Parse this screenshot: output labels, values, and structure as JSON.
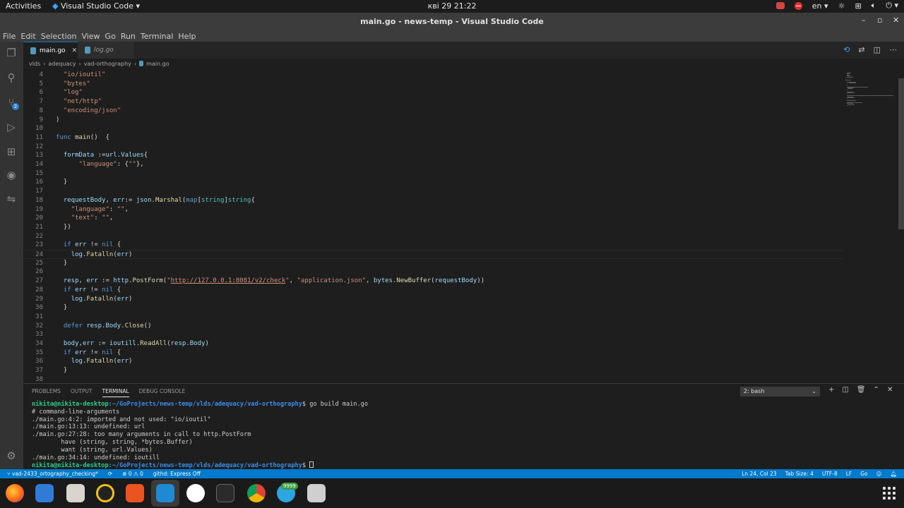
{
  "topbar": {
    "activities": "Activities",
    "app_name": "Visual Studio Code",
    "clock": "кві 29  21:22",
    "lang": "en"
  },
  "window": {
    "title": "main.go - news-temp - Visual Studio Code"
  },
  "menu": [
    "File",
    "Edit",
    "Selection",
    "View",
    "Go",
    "Run",
    "Terminal",
    "Help"
  ],
  "source_control_badge": "2",
  "tabs": [
    {
      "label": "main.go",
      "active": true
    },
    {
      "label": "log.go",
      "active": false
    }
  ],
  "breadcrumb": [
    "vlds",
    "adequacy",
    "vad-orthography",
    "main.go"
  ],
  "editor": {
    "lines": [
      {
        "n": "4",
        "text": "  \"io/ioutil\""
      },
      {
        "n": "5",
        "text": "  \"bytes\""
      },
      {
        "n": "6",
        "text": "  \"log\""
      },
      {
        "n": "7",
        "text": "  \"net/http\""
      },
      {
        "n": "8",
        "text": "  \"encoding/json\""
      },
      {
        "n": "9",
        "text": ")"
      },
      {
        "n": "10",
        "text": ""
      },
      {
        "n": "11",
        "text": "func main()  {"
      },
      {
        "n": "12",
        "text": ""
      },
      {
        "n": "13",
        "text": "  formData :=url.Values{"
      },
      {
        "n": "14",
        "text": "      \"language\": {\"\"},"
      },
      {
        "n": "15",
        "text": ""
      },
      {
        "n": "16",
        "text": "  }"
      },
      {
        "n": "17",
        "text": ""
      },
      {
        "n": "18",
        "text": "  requestBody, err:= json.Marshal(map[string]string{"
      },
      {
        "n": "19",
        "text": "    \"language\": \"\","
      },
      {
        "n": "20",
        "text": "    \"text\": \"\","
      },
      {
        "n": "21",
        "text": "  })"
      },
      {
        "n": "22",
        "text": ""
      },
      {
        "n": "23",
        "text": "  if err != nil {"
      },
      {
        "n": "24",
        "text": "    log.Fatalln(err)"
      },
      {
        "n": "25",
        "text": "  }"
      },
      {
        "n": "26",
        "text": ""
      },
      {
        "n": "27",
        "text": "  resp, err := http.PostForm(\"http://127.0.0.1:8081/v2/check\", \"application.json\", bytes.NewBuffer(requestBody))"
      },
      {
        "n": "28",
        "text": "  if err != nil {"
      },
      {
        "n": "29",
        "text": "    log.Fatalln(err)"
      },
      {
        "n": "30",
        "text": "  }"
      },
      {
        "n": "31",
        "text": ""
      },
      {
        "n": "32",
        "text": "  defer resp.Body.Close()"
      },
      {
        "n": "33",
        "text": ""
      },
      {
        "n": "34",
        "text": "  body,err := ioutill.ReadAll(resp.Body)"
      },
      {
        "n": "35",
        "text": "  if err != nil {"
      },
      {
        "n": "36",
        "text": "    log.Fatalln(err)"
      },
      {
        "n": "37",
        "text": "  }"
      },
      {
        "n": "38",
        "text": ""
      }
    ]
  },
  "panel": {
    "tabs": [
      "PROBLEMS",
      "OUTPUT",
      "TERMINAL",
      "DEBUG CONSOLE"
    ],
    "active_tab": "TERMINAL",
    "terminal_select": "2: bash",
    "prompt_user": "nikita@nikita-desktop",
    "prompt_path": ":~/GoProjects/news-temp/vlds/adequacy/vad-orthography",
    "command": "$ go build main.go",
    "output": [
      "# command-line-arguments",
      "./main.go:4:2: imported and not used: \"io/ioutil\"",
      "./main.go:13:13: undefined: url",
      "./main.go:27:28: too many arguments in call to http.PostForm",
      "        have (string, string, *bytes.Buffer)",
      "        want (string, url.Values)",
      "./main.go:34:14: undefined: ioutill"
    ],
    "prompt_end": "$ "
  },
  "statusbar": {
    "branch": "vad-2433_ortography_checking*",
    "problems": "⊗ 0 ⚠ 0",
    "githd": "githd: Express Off",
    "cursor": "Ln 24, Col 23",
    "tab_size": "Tab Size: 4",
    "encoding": "UTF-8",
    "eol": "LF",
    "language": "Go"
  },
  "dock": {
    "telegram_badge": "9999"
  },
  "colors": {
    "accent": "#007acc",
    "editor_bg": "#1e1e1e",
    "prompt_user": "#23d18b",
    "prompt_path": "#3b8eea"
  }
}
